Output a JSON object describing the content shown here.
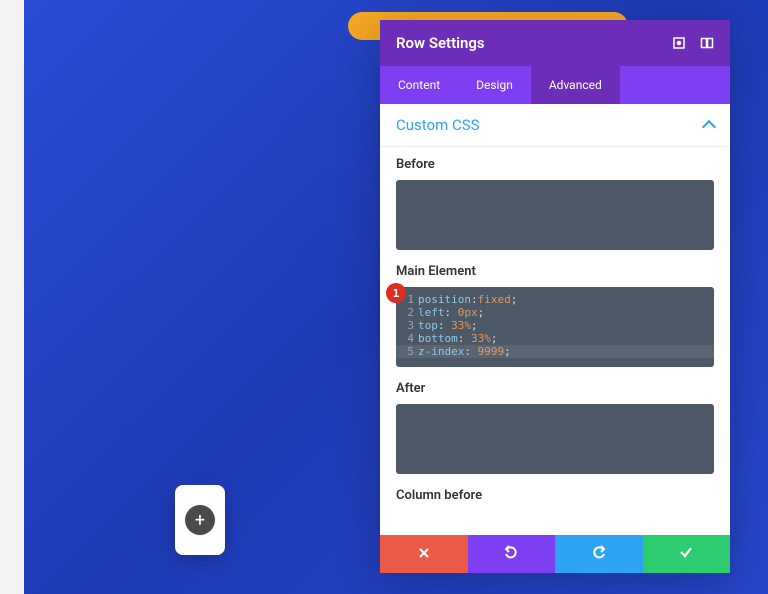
{
  "panel": {
    "title": "Row Settings",
    "tabs": [
      {
        "label": "Content",
        "active": false
      },
      {
        "label": "Design",
        "active": false
      },
      {
        "label": "Advanced",
        "active": true
      }
    ],
    "section": {
      "title": "Custom CSS"
    },
    "fields": {
      "before": {
        "label": "Before",
        "value": ""
      },
      "main": {
        "label": "Main Element",
        "badge": "1",
        "lines": [
          {
            "n": "1",
            "prop": "position",
            "sep": ":",
            "val": "fixed",
            "end": ";"
          },
          {
            "n": "2",
            "prop": "left",
            "sep": ": ",
            "val": "0px",
            "end": ";"
          },
          {
            "n": "3",
            "prop": "top",
            "sep": ": ",
            "val": "33%",
            "end": ";"
          },
          {
            "n": "4",
            "prop": "bottom",
            "sep": ": ",
            "val": "33%",
            "end": ";"
          },
          {
            "n": "5",
            "prop": "z-index",
            "sep": ": ",
            "val": "9999",
            "end": ";",
            "hl": true
          }
        ]
      },
      "after": {
        "label": "After",
        "value": ""
      },
      "column_before": {
        "label": "Column before"
      }
    }
  },
  "icons": {
    "expand": "expand-icon",
    "drag": "drag-icon",
    "cancel": "close-icon",
    "undo": "undo-icon",
    "redo": "redo-icon",
    "save": "check-icon",
    "add": "plus-icon"
  },
  "colors": {
    "header": "#6c2eb9",
    "tabbar": "#7e3ff2",
    "accent_blue": "#2ea3f2",
    "code_bg": "#4c5866",
    "cancel": "#eb5a46",
    "save": "#2ecc71",
    "badge": "#e02b20"
  }
}
